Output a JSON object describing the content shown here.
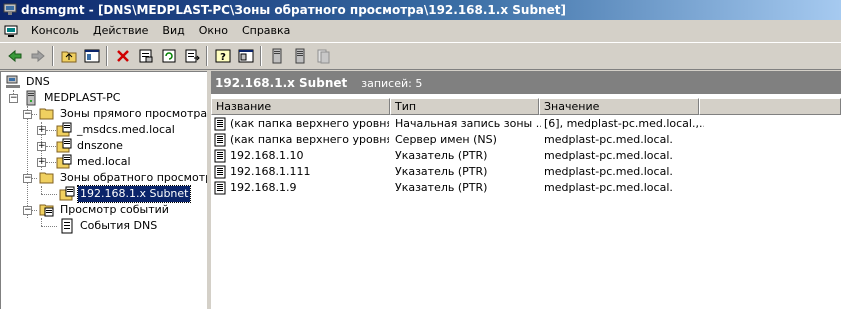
{
  "window": {
    "title": "dnsmgmt - [DNS\\MEDPLAST-PC\\Зоны обратного просмотра\\192.168.1.x Subnet]"
  },
  "menu": [
    "Консоль",
    "Действие",
    "Вид",
    "Окно",
    "Справка"
  ],
  "toolbar": [
    "back-icon",
    "forward-icon",
    "sep",
    "up-folder-icon",
    "show-hide-tree-icon",
    "sep",
    "delete-icon",
    "properties-icon",
    "refresh-icon",
    "export-list-icon",
    "sep",
    "help-icon",
    "console-tree-icon",
    "sep",
    "server-icon",
    "server-alt-icon",
    "server-disabled-icon"
  ],
  "tree": {
    "root": "DNS",
    "server": "MEDPLAST-PC",
    "forward": "Зоны прямого просмотра",
    "forward_zones": [
      "_msdcs.med.local",
      "dnszone",
      "med.local"
    ],
    "reverse": "Зоны обратного просмотра",
    "reverse_zone": "192.168.1.x Subnet",
    "events": "Просмотр событий",
    "dns_events": "События DNS"
  },
  "details": {
    "title": "192.168.1.x Subnet",
    "count": "записей: 5",
    "columns": [
      "Название",
      "Тип",
      "Значение"
    ],
    "rows": [
      {
        "name": "(как папка верхнего уровня)",
        "type": "Начальная запись зоны ...",
        "value": "[6], medplast-pc.med.local.,..."
      },
      {
        "name": "(как папка верхнего уровня)",
        "type": "Сервер имен (NS)",
        "value": "medplast-pc.med.local."
      },
      {
        "name": "192.168.1.10",
        "type": "Указатель (PTR)",
        "value": "medplast-pc.med.local."
      },
      {
        "name": "192.168.1.111",
        "type": "Указатель (PTR)",
        "value": "medplast-pc.med.local."
      },
      {
        "name": "192.168.1.9",
        "type": "Указатель (PTR)",
        "value": "medplast-pc.med.local."
      }
    ]
  }
}
